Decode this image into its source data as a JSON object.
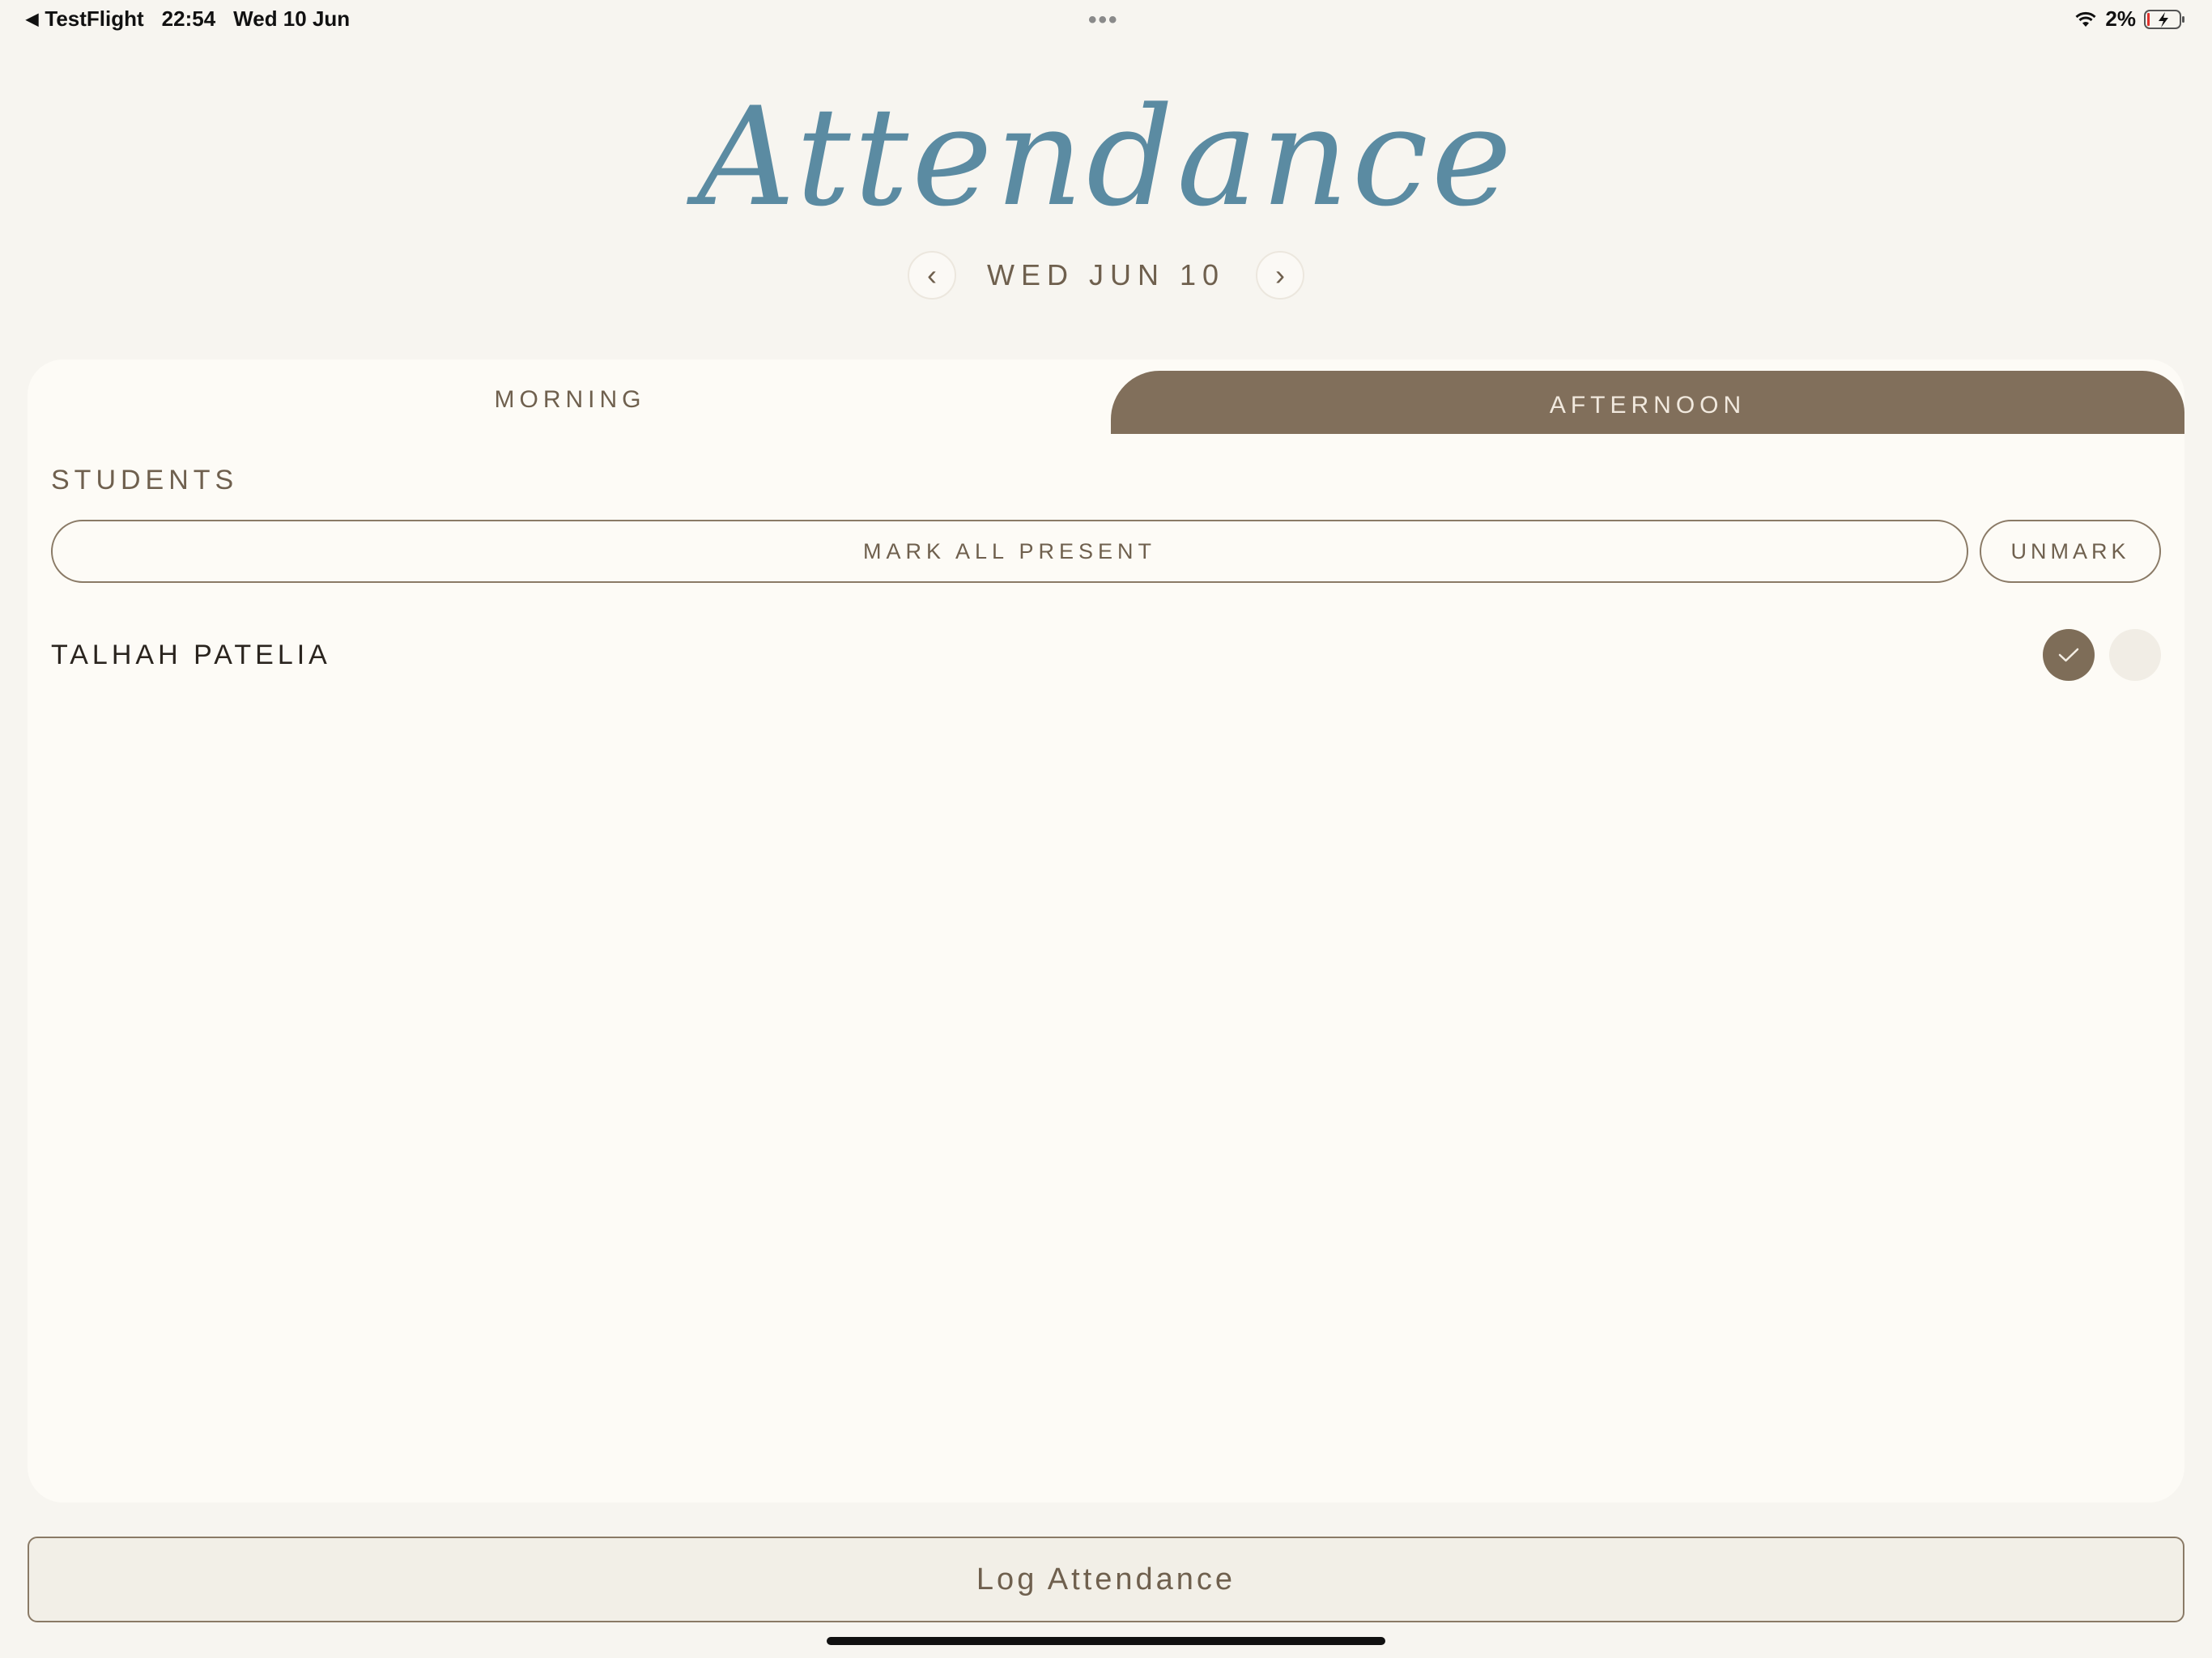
{
  "status_bar": {
    "back_app": "TestFlight",
    "time": "22:54",
    "date": "Wed 10 Jun",
    "battery": "2%"
  },
  "header": {
    "title": "Attendance",
    "date": "WED JUN 10",
    "prev_glyph": "‹",
    "next_glyph": "›"
  },
  "tabs": {
    "morning": "MORNING",
    "afternoon": "AFTERNOON"
  },
  "students": {
    "section_label": "STUDENTS",
    "mark_all_label": "MARK ALL PRESENT",
    "unmark_label": "UNMARK",
    "items": [
      {
        "name": "TALHAH PATELIA",
        "status": "present"
      }
    ]
  },
  "footer": {
    "log_label": "Log Attendance"
  },
  "colors": {
    "accent": "#7e6d58",
    "title": "#5b8ba2",
    "background": "#f7f5f0",
    "card": "#fdfbf6"
  }
}
